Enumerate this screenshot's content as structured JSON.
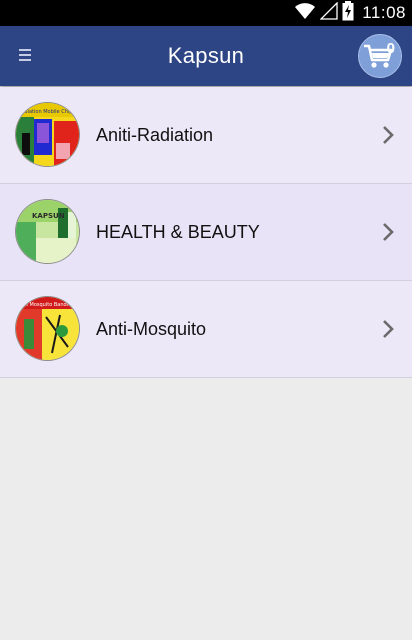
{
  "status_bar": {
    "time": "11:08",
    "icons": [
      "wifi-icon",
      "signal-icon",
      "battery-charging-icon"
    ]
  },
  "app_bar": {
    "menu_icon": "menu-icon",
    "title": "Kapsun",
    "cart": {
      "icon": "cart-icon",
      "count": "0"
    }
  },
  "colors": {
    "status_bar": "#000000",
    "app_bar": "#2e4585",
    "cart_circle": "#7f9fd8",
    "list_item_bg": "#ece8f8",
    "page_bg": "#ececec"
  },
  "categories": [
    {
      "label": "Aniti-Radiation",
      "thumb_text": "Radiation Mobile Chip",
      "icon": "chevron-right-icon"
    },
    {
      "label": "HEALTH & BEAUTY",
      "thumb_text": "KAPSUN",
      "icon": "chevron-right-icon"
    },
    {
      "label": "Anti-Mosquito",
      "thumb_text": "Anti Mosquito Bandle",
      "icon": "chevron-right-icon"
    }
  ]
}
